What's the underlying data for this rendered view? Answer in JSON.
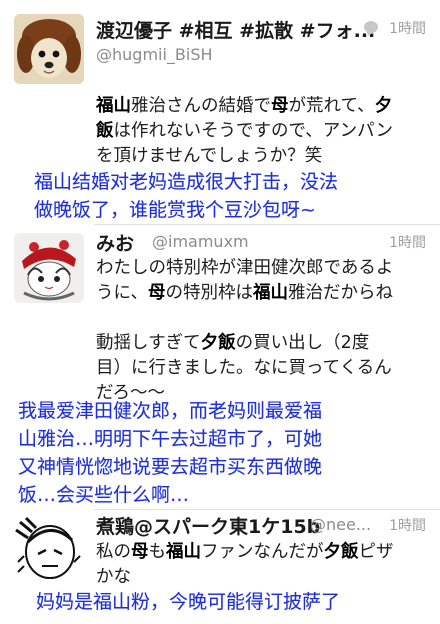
{
  "tweets": [
    {
      "name": "渡辺優子 #相互 #拡散 #フォ...",
      "handle": "@hugmii_BiSH",
      "time": "1時間",
      "body_parts": [
        {
          "t": "福山",
          "b": true
        },
        {
          "t": "雅治さんの結婚で",
          "b": false
        },
        {
          "t": "母",
          "b": true
        },
        {
          "t": "が荒れて、",
          "b": false
        },
        {
          "t": "夕\n飯",
          "b": true
        },
        {
          "t": "は作れないそうですので、アンパン\nを頂けませんでしょうか？笑",
          "b": false
        }
      ]
    },
    {
      "name": "みお",
      "handle": "@imamuxm",
      "time": "1時間",
      "body_parts": [
        {
          "t": "わたしの特別枠が津田健次郎であるよ\nうに、",
          "b": false
        },
        {
          "t": "母",
          "b": true
        },
        {
          "t": "の特別枠は",
          "b": false
        },
        {
          "t": "福山",
          "b": true
        },
        {
          "t": "雅治だからね\n\n動揺しすぎて",
          "b": false
        },
        {
          "t": "夕飯",
          "b": true
        },
        {
          "t": "の買い出し（2度\n目）に行きました。なに買ってくるん\nだろ〜〜",
          "b": false
        }
      ]
    },
    {
      "name": "煮鶏@スパーク東1ケ15b",
      "handle": "@nee...",
      "time": "1時間",
      "body_parts": [
        {
          "t": "私の",
          "b": false
        },
        {
          "t": "母",
          "b": true
        },
        {
          "t": "も",
          "b": false
        },
        {
          "t": "福山",
          "b": true
        },
        {
          "t": "ファンなんだが",
          "b": false
        },
        {
          "t": "夕飯",
          "b": true
        },
        {
          "t": "ピザ\nかな",
          "b": false
        }
      ]
    }
  ],
  "translations": [
    "福山结婚对老妈造成很大打击，没法\n做晚饭了，谁能赏我个豆沙包呀~",
    "我最爱津田健次郎，而老妈则最爱福\n山雅治…明明下午去过超市了，可她\n又神情恍惚地说要去超市买东西做晚\n饭…会买些什么啊…",
    "妈妈是福山粉，今晚可能得订披萨了"
  ],
  "colors": {
    "translation_text": "#1e2fd8",
    "handle_gray": "#8b8b8b",
    "divider": "#e2e2e2"
  },
  "icons": [
    "dog-avatar",
    "manga-girl-avatar",
    "sketch-avatar",
    "speech-bubble-icon"
  ]
}
